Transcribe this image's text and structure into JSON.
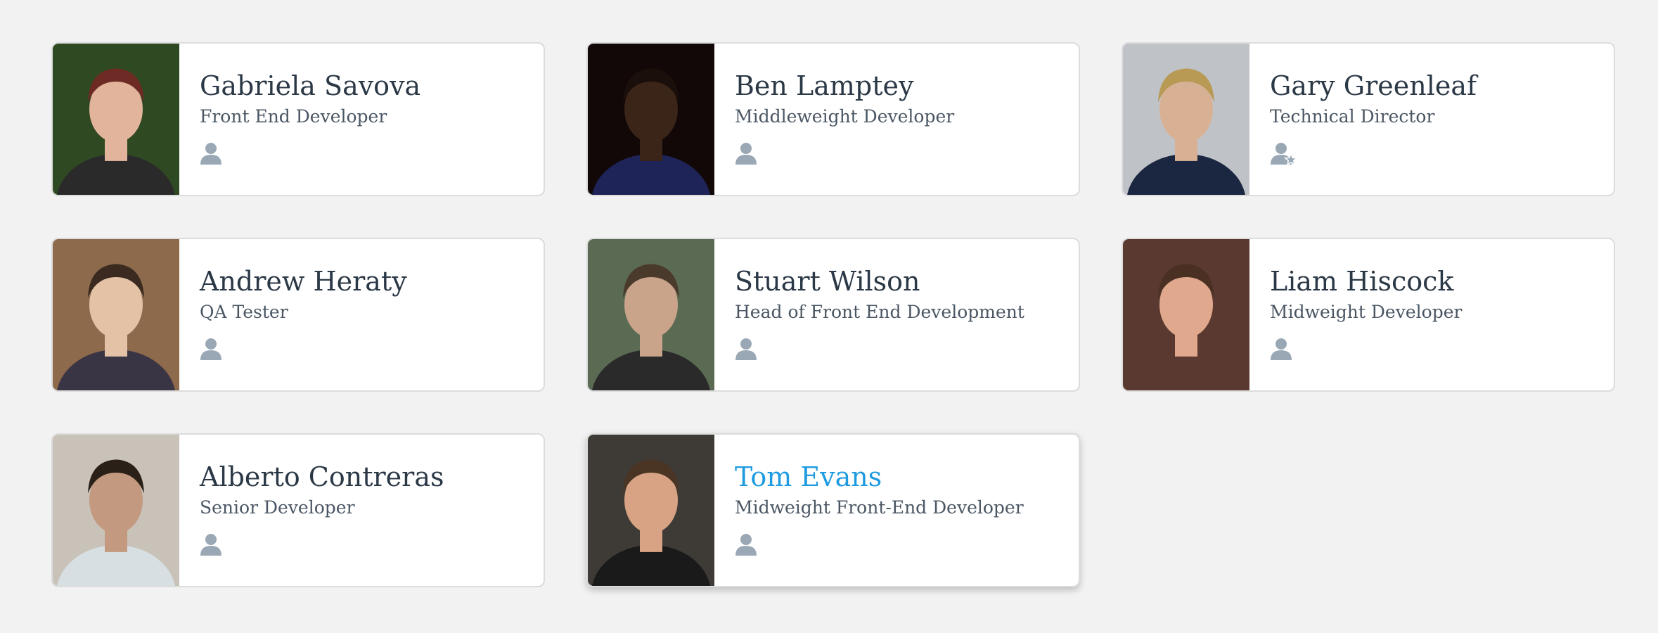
{
  "people": [
    {
      "name": "Gabriela Savova",
      "role": "Front End Developer",
      "icon": "user-icon",
      "photo": {
        "bg": "#2f4a22",
        "skin": "#e2b49c",
        "hair": "#6e2a24",
        "shirt": "#2a2a2a"
      }
    },
    {
      "name": "Ben Lamptey",
      "role": "Middleweight Developer",
      "icon": "user-icon",
      "photo": {
        "bg": "#120808",
        "skin": "#3b2418",
        "hair": "#1a0f0a",
        "shirt": "#1e2458"
      }
    },
    {
      "name": "Gary Greenleaf",
      "role": "Technical Director",
      "icon": "user-star-icon",
      "photo": {
        "bg": "#bfc3c7",
        "skin": "#d8b195",
        "hair": "#b89a55",
        "shirt": "#1b2640"
      }
    },
    {
      "name": "Andrew Heraty",
      "role": "QA Tester",
      "icon": "user-icon",
      "photo": {
        "bg": "#8e6a4c",
        "skin": "#e4c2a6",
        "hair": "#3a2a20",
        "shirt": "#3a3544"
      }
    },
    {
      "name": "Stuart Wilson",
      "role": "Head of Front End Development",
      "icon": "user-icon",
      "photo": {
        "bg": "#5b6a52",
        "skin": "#c9a48a",
        "hair": "#4a3a2c",
        "shirt": "#2a2a2a"
      }
    },
    {
      "name": "Liam Hiscock",
      "role": "Midweight Developer",
      "icon": "user-icon",
      "photo": {
        "bg": "#5a3a30",
        "skin": "#e0a98e",
        "hair": "#4a3022",
        "shirt": "#5a3a30"
      }
    },
    {
      "name": "Alberto Contreras",
      "role": "Senior Developer",
      "icon": "user-icon",
      "photo": {
        "bg": "#c8c2b8",
        "skin": "#c39a80",
        "hair": "#2b2018",
        "shirt": "#d7dfe2"
      }
    },
    {
      "name": "Tom Evans",
      "role": "Midweight Front-End Developer",
      "icon": "user-icon",
      "photo": {
        "bg": "#3e3a36",
        "skin": "#d7a384",
        "hair": "#4a3424",
        "shirt": "#1a1a1a"
      }
    }
  ],
  "highlight_index": 7,
  "colors": {
    "icon": "#9aa8b5",
    "name": "#2b3846",
    "highlight": "#1e9be0",
    "role": "#4a5663"
  }
}
